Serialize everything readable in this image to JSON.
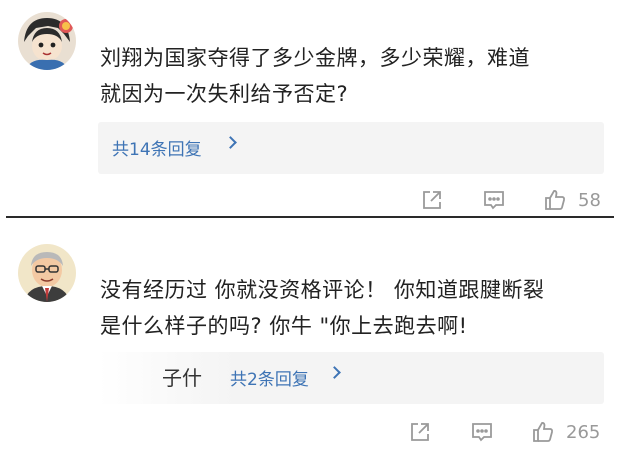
{
  "comments": [
    {
      "text_lines": [
        "刘翔为国家夺得了多少金牌，多少荣耀，难道",
        "就因为一次失利给予否定?"
      ],
      "replies_label": "共14条回复",
      "likes": "58"
    },
    {
      "text_lines": [
        "没有经历过 你就没资格评论！ 你知道跟腱断裂",
        "是什么样子的吗? 你牛   \"你上去跑去啊!"
      ],
      "reply_author": "子什",
      "replies_label": "共2条回复",
      "likes": "265"
    }
  ],
  "icons": [
    "share-icon",
    "comment-icon",
    "like-icon"
  ],
  "colors": {
    "link": "#3e74b5",
    "muted": "#999999",
    "reply_bg": "#f4f4f4"
  }
}
